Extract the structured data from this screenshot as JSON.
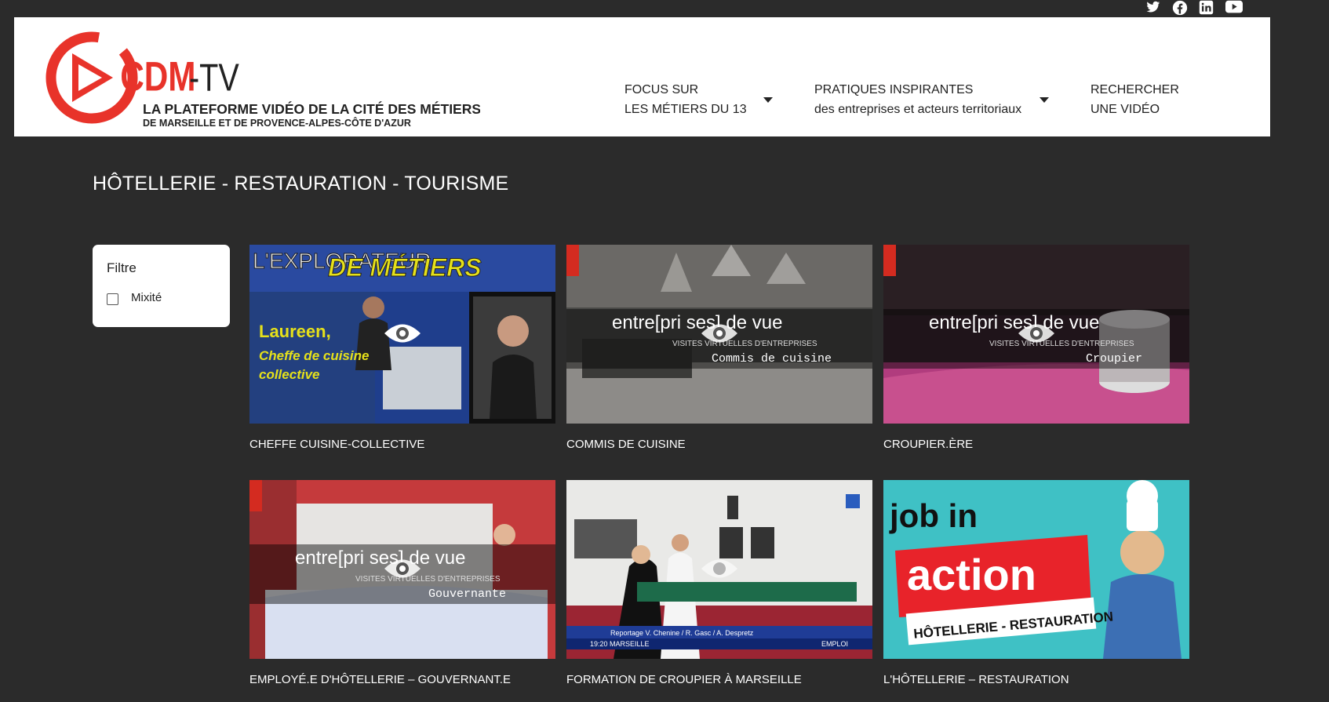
{
  "social": [
    "twitter-icon",
    "facebook-icon",
    "linkedin-icon",
    "youtube-icon"
  ],
  "logo": {
    "brand_main": "CDM",
    "brand_suffix": "-TV",
    "tagline_1": "LA PLATEFORME VIDÉO DE LA CITÉ DES MÉTIERS",
    "tagline_2": "DE MARSEILLE ET DE PROVENCE-ALPES-CÔTE D'AZUR",
    "color": "#e8332a"
  },
  "nav": {
    "focus": {
      "line1": "FOCUS SUR",
      "line2": "LES MÉTIERS DU 13"
    },
    "pratiques": {
      "line1": "PRATIQUES INSPIRANTES",
      "line2": "des entreprises et acteurs territoriaux"
    },
    "recherche": {
      "line1": "RECHERCHER",
      "line2": "UNE VIDÉO"
    }
  },
  "page_title": "HÔTELLERIE - RESTAURATION - TOURISME",
  "filter": {
    "title": "Filtre",
    "option": "Mixité"
  },
  "cards": [
    {
      "title": "CHEFFE CUISINE-COLLECTIVE",
      "thumb_lines": [
        "L'EXPLORATEUR",
        "DE MÉTIERS",
        "Laureen,",
        "Cheffe de cuisine",
        "collective"
      ]
    },
    {
      "title": "COMMIS DE CUISINE",
      "thumb_lines": [
        "entre[pri ses] de vue",
        "VISITES VIRTUELLES D'ENTREPRISES",
        "Commis de cuisine"
      ]
    },
    {
      "title": "CROUPIER.ÈRE",
      "thumb_lines": [
        "entre[pri ses] de vue",
        "VISITES VIRTUELLES D'ENTREPRISES",
        "Croupier"
      ]
    },
    {
      "title": "EMPLOYÉ.E D'HÔTELLERIE – GOUVERNANT.E",
      "thumb_lines": [
        "entre[pri ses] de vue",
        "VISITES VIRTUELLES D'ENTREPRISES",
        "Gouvernante"
      ]
    },
    {
      "title": "FORMATION DE CROUPIER À MARSEILLE",
      "thumb_lines": [
        "Reportage V. Chenine / R. Gasc / A. Despretz",
        "19:20 MARSEILLE",
        "EMPLOI"
      ]
    },
    {
      "title": "L'HÔTELLERIE – RESTAURATION",
      "thumb_lines": [
        "job in",
        "action",
        "HÔTELLERIE - RESTAURATION"
      ]
    }
  ]
}
